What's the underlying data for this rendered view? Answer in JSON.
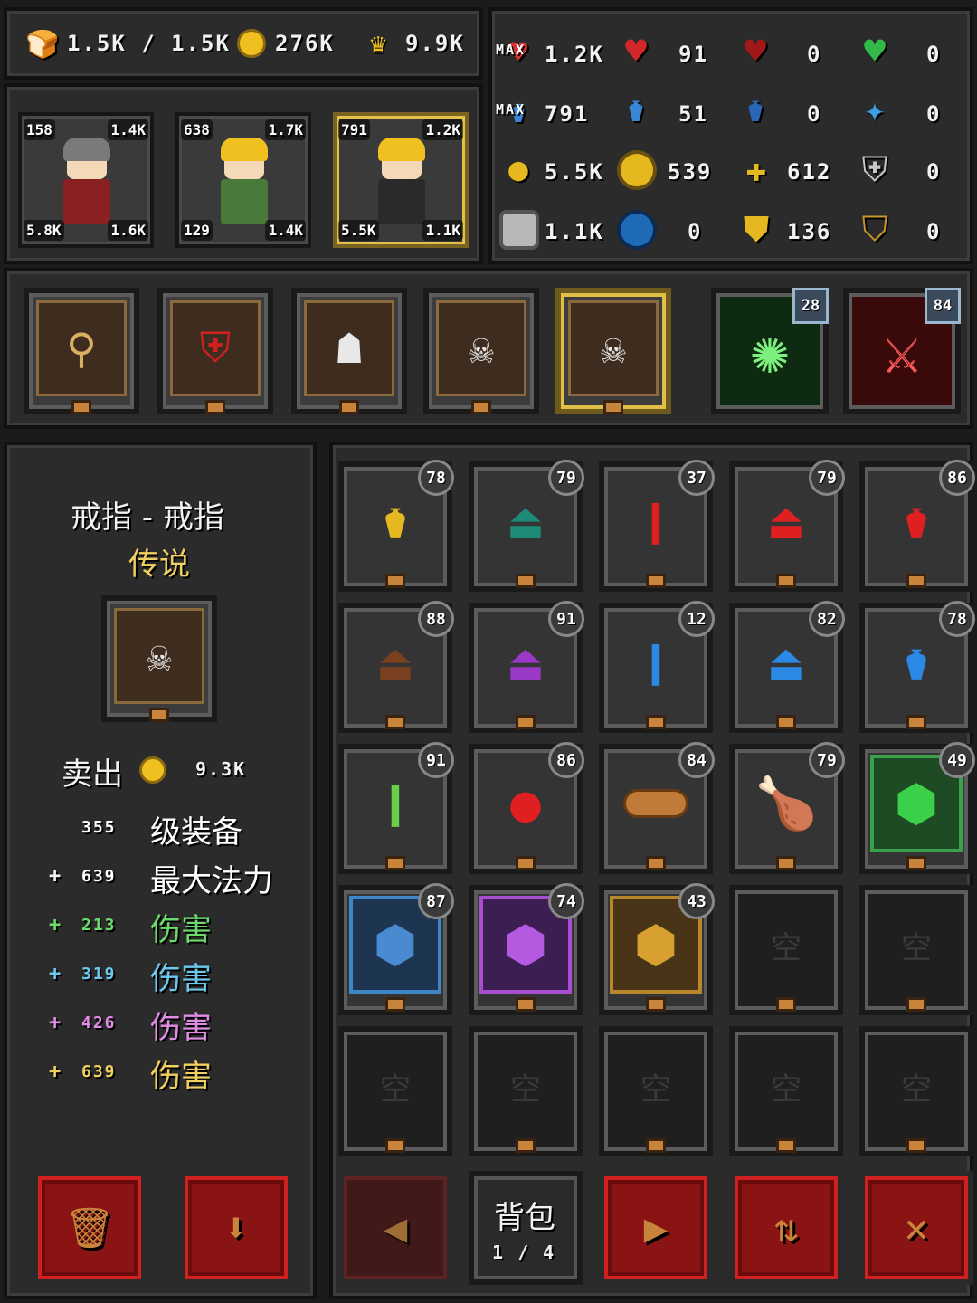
{
  "resources": {
    "food": "1.5K / 1.5K",
    "gold": "276K",
    "crown": "9.9K"
  },
  "party": [
    {
      "mp": "158",
      "hp": "1.4K",
      "gold": "5.8K",
      "attack": "1.6K"
    },
    {
      "mp": "638",
      "hp": "1.7K",
      "gold": "129",
      "attack": "1.4K"
    },
    {
      "mp": "791",
      "hp": "1.2K",
      "gold": "5.5K",
      "attack": "1.1K"
    }
  ],
  "stats": {
    "row1": {
      "max_label": "MAX",
      "max_hp": "1.2K",
      "hp_plus": "91",
      "hp_s": "0",
      "hp_green": "0"
    },
    "row2": {
      "max_label": "MAX",
      "max_mp": "791",
      "mp_plus": "51",
      "mp_s": "0",
      "mp_star": "0"
    },
    "row3": {
      "gold_bag": "5.5K",
      "coin": "539",
      "sparkle": "612",
      "shield_silver": "0"
    },
    "row4": {
      "silver": "1.1K",
      "blue_orb": "0",
      "gold_shield": "136",
      "gold_badge": "0"
    }
  },
  "skills": [
    {
      "level": "28"
    },
    {
      "level": "84"
    }
  ],
  "detail": {
    "title": "戒指 - 戒指",
    "rarity": "传说",
    "sell_label": "卖出",
    "sell_price": "9.3K",
    "stats": [
      {
        "prefix": "",
        "value": "355",
        "label": "级装备",
        "color": "#ffffff"
      },
      {
        "prefix": "+",
        "value": "639",
        "label": "最大法力",
        "color": "#ffffff"
      },
      {
        "prefix": "+",
        "value": "213",
        "label": "伤害",
        "color": "#6bdc6b"
      },
      {
        "prefix": "+",
        "value": "319",
        "label": "伤害",
        "color": "#6cc8ec"
      },
      {
        "prefix": "+",
        "value": "426",
        "label": "伤害",
        "color": "#e28ce6"
      },
      {
        "prefix": "+",
        "value": "639",
        "label": "伤害",
        "color": "#f0d060"
      }
    ]
  },
  "inventory": {
    "page_label": "背包",
    "page": "1 / 4",
    "empty_label": "空",
    "items": [
      {
        "icon": "yellow-potion",
        "count": "78"
      },
      {
        "icon": "teal-flask",
        "count": "79"
      },
      {
        "icon": "red-vial",
        "count": "37"
      },
      {
        "icon": "red-flask",
        "count": "79"
      },
      {
        "icon": "red-round-potion",
        "count": "86"
      },
      {
        "icon": "brown-flask",
        "count": "88"
      },
      {
        "icon": "purple-flask",
        "count": "91"
      },
      {
        "icon": "blue-vial",
        "count": "12"
      },
      {
        "icon": "blue-flask",
        "count": "82"
      },
      {
        "icon": "blue-round-potion",
        "count": "78"
      },
      {
        "icon": "green-vial",
        "count": "91"
      },
      {
        "icon": "apple",
        "count": "86"
      },
      {
        "icon": "bread",
        "count": "84"
      },
      {
        "icon": "chicken-leg",
        "count": "79"
      },
      {
        "icon": "green-gem",
        "count": "49"
      },
      {
        "icon": "blue-gem",
        "count": "87"
      },
      {
        "icon": "purple-gem",
        "count": "74"
      },
      {
        "icon": "gold-gem",
        "count": "43"
      }
    ]
  }
}
